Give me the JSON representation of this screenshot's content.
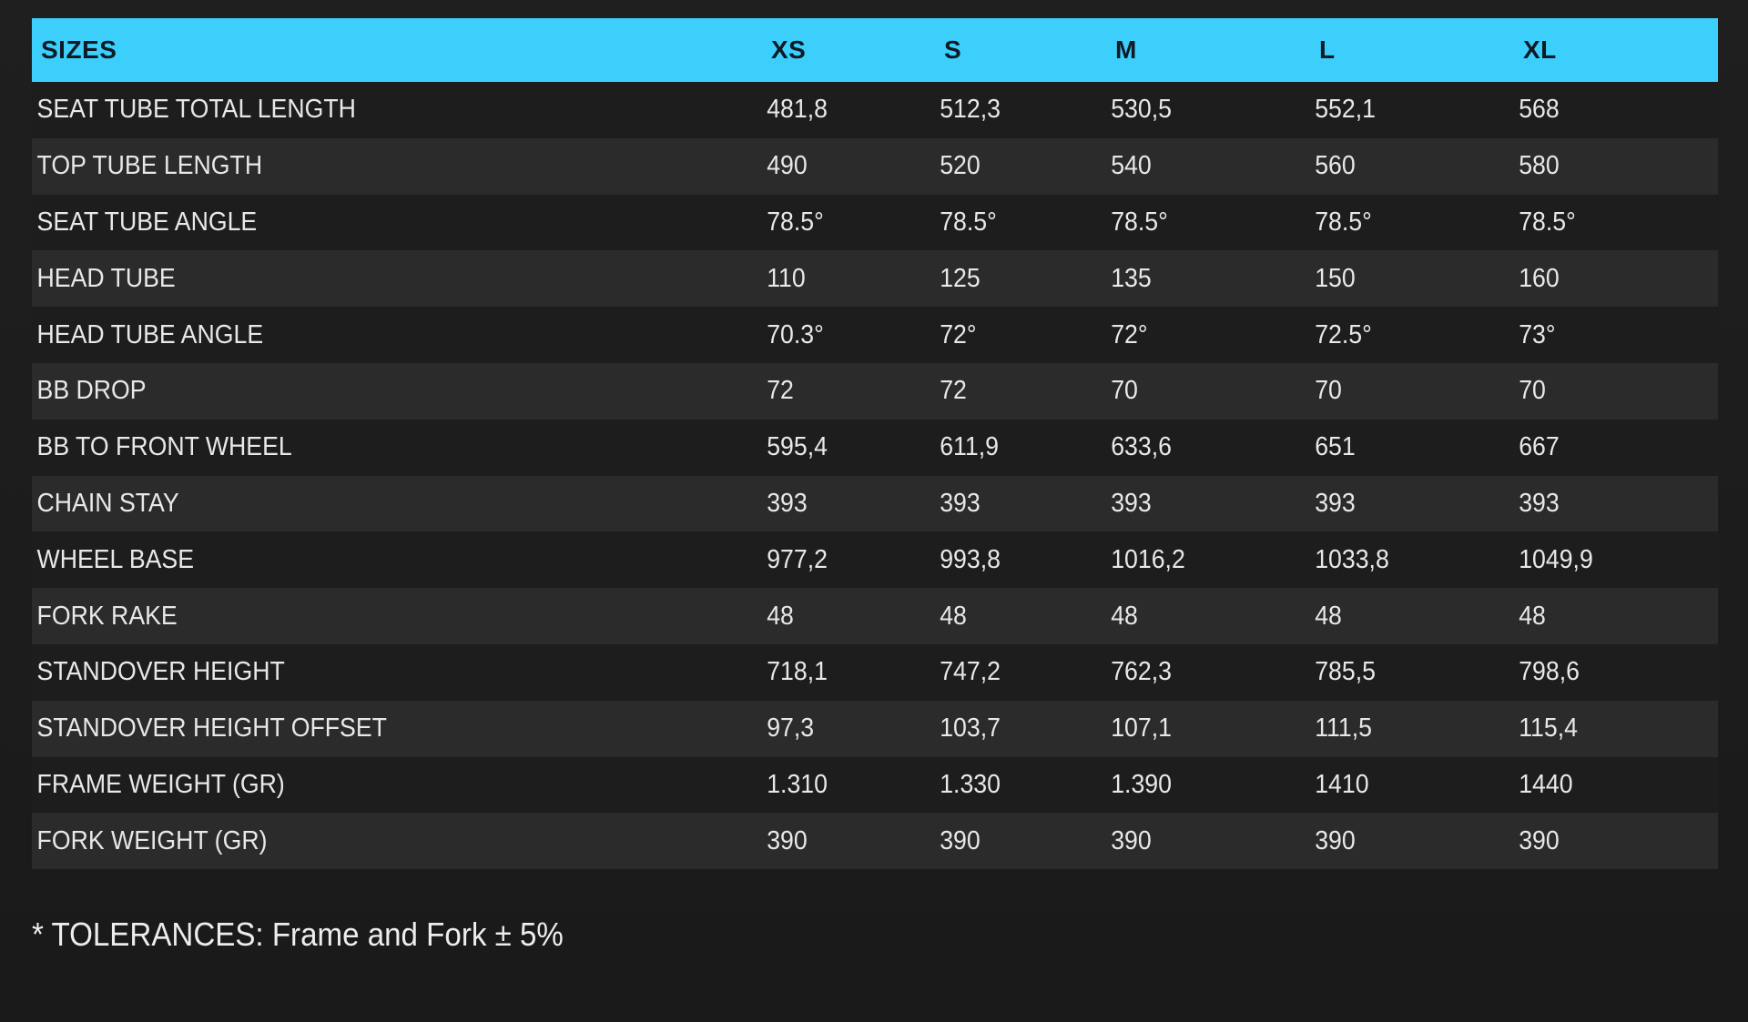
{
  "table": {
    "headers": [
      "SIZES",
      "XS",
      "S",
      "M",
      "L",
      "XL"
    ],
    "rows": [
      {
        "label": "SEAT TUBE TOTAL LENGTH",
        "values": [
          "481,8",
          "512,3",
          "530,5",
          "552,1",
          "568"
        ]
      },
      {
        "label": "TOP TUBE LENGTH",
        "values": [
          "490",
          "520",
          "540",
          "560",
          "580"
        ]
      },
      {
        "label": "SEAT TUBE ANGLE",
        "values": [
          "78.5°",
          "78.5°",
          "78.5°",
          "78.5°",
          "78.5°"
        ]
      },
      {
        "label": "HEAD TUBE",
        "values": [
          "110",
          "125",
          "135",
          "150",
          "160"
        ]
      },
      {
        "label": "HEAD TUBE ANGLE",
        "values": [
          "70.3°",
          "72°",
          "72°",
          "72.5°",
          "73°"
        ]
      },
      {
        "label": "BB DROP",
        "values": [
          "72",
          "72",
          "70",
          "70",
          "70"
        ]
      },
      {
        "label": "BB TO FRONT WHEEL",
        "values": [
          "595,4",
          "611,9",
          "633,6",
          "651",
          "667"
        ]
      },
      {
        "label": "CHAIN STAY",
        "values": [
          "393",
          "393",
          "393",
          "393",
          "393"
        ]
      },
      {
        "label": "WHEEL BASE",
        "values": [
          "977,2",
          "993,8",
          "1016,2",
          "1033,8",
          "1049,9"
        ]
      },
      {
        "label": "FORK RAKE",
        "values": [
          "48",
          "48",
          "48",
          "48",
          "48"
        ]
      },
      {
        "label": "STANDOVER HEIGHT",
        "values": [
          "718,1",
          "747,2",
          "762,3",
          "785,5",
          "798,6"
        ]
      },
      {
        "label": "STANDOVER HEIGHT OFFSET",
        "values": [
          "97,3",
          "103,7",
          "107,1",
          "111,5",
          "115,4"
        ]
      },
      {
        "label": "FRAME WEIGHT (GR)",
        "values": [
          "1.310",
          "1.330",
          "1.390",
          "1410",
          "1440"
        ]
      },
      {
        "label": "FORK WEIGHT (GR)",
        "values": [
          "390",
          "390",
          "390",
          "390",
          "390"
        ]
      }
    ]
  },
  "footnote": "* TOLERANCES: Frame and Fork ± 5%",
  "colors": {
    "header_background": "#3ccffb",
    "header_text": "#0f1a26",
    "page_background": "#1e1e1e",
    "row_dark": "#1d1d1d",
    "row_light": "#2b2b2b",
    "cell_text": "#e8e8e8"
  }
}
